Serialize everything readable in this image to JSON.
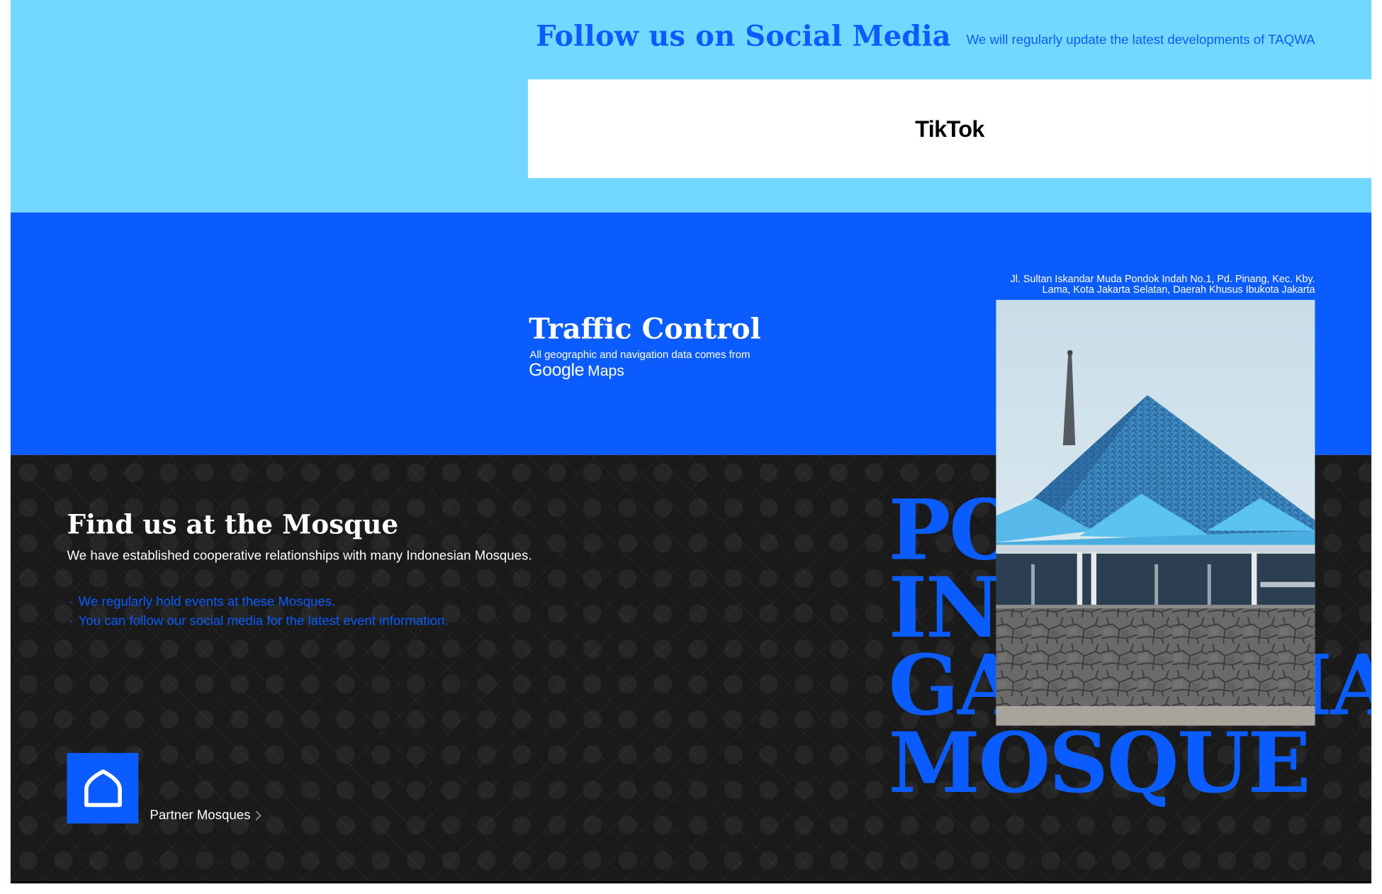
{
  "social": {
    "title": "Follow us on Social Media",
    "subtitle": "We will regularly update the latest developments of TAQWA",
    "platform": "TikTok"
  },
  "traffic": {
    "title": "Traffic Control",
    "subtitle": "All geographic and navigation data comes from",
    "provider_brand": "Google",
    "provider_product": "Maps",
    "address": "Jl. Sultan Iskandar Muda Pondok Indah No.1, Pd. Pinang, Kec. Kby. Lama, Kota Jakarta Selatan, Daerah Khusus Ibukota Jakarta"
  },
  "mosque": {
    "title": "Find us at the Mosque",
    "description": "We have established cooperative relationships with many Indonesian Mosques.",
    "events": [
      "We regularly hold events at these Mosques.",
      "You can follow our social media for the latest event information."
    ],
    "partner_link": "Partner Mosques",
    "name_lines": [
      "PONDOK",
      "INDAH",
      "GANDARIA",
      "MOSQUE"
    ]
  },
  "colors": {
    "sky": "#72d8ff",
    "brand_blue": "#0b5cff",
    "dark": "#1a1a1a"
  },
  "icons": {
    "partner": "mosque-dome-icon",
    "chevron": "chevron-right-icon"
  }
}
